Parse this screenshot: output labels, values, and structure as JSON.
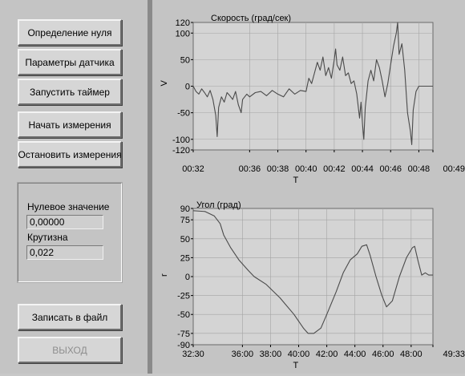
{
  "buttons": {
    "zero": "Определение нуля",
    "sensor_params": "Параметры датчика",
    "start_timer": "Запустить таймер",
    "start_measure": "Начать измерения",
    "stop_measure": "Остановить измерения",
    "save_file": "Записать в файл",
    "exit": "ВЫХОД"
  },
  "settings": {
    "zero_label": "Нулевое значение",
    "zero_value": "0,00000",
    "slope_label": "Крутизна",
    "slope_value": "0,022"
  },
  "colors": {
    "plot_bg": "#d4d4d4",
    "trace": "#4a4a4a",
    "grid": "#a4a4a4"
  },
  "chart_data": [
    {
      "type": "line",
      "title": "Скорость (град/сек)",
      "xlabel": "T",
      "ylabel": "V",
      "ylim": [
        -120,
        120
      ],
      "yticks": [
        120,
        100,
        50,
        0,
        -50,
        -100,
        -120
      ],
      "x_ticks": [
        "00:32",
        "00:36",
        "00:38",
        "00:40",
        "00:42",
        "00:44",
        "00:46",
        "00:48",
        "00:49"
      ],
      "x_tick_seconds": [
        32,
        36,
        38,
        40,
        42,
        44,
        46,
        48,
        49
      ],
      "xlim_seconds": [
        32,
        49
      ],
      "grid": true,
      "series": [
        {
          "points": [
            [
              32.0,
              0
            ],
            [
              32.2,
              -10
            ],
            [
              32.4,
              -15
            ],
            [
              32.6,
              -5
            ],
            [
              32.8,
              -12
            ],
            [
              33.0,
              -20
            ],
            [
              33.2,
              -8
            ],
            [
              33.4,
              -25
            ],
            [
              33.6,
              -55
            ],
            [
              33.7,
              -95
            ],
            [
              33.8,
              -40
            ],
            [
              34.0,
              -20
            ],
            [
              34.2,
              -30
            ],
            [
              34.4,
              -12
            ],
            [
              34.6,
              -18
            ],
            [
              34.8,
              -25
            ],
            [
              35.0,
              -10
            ],
            [
              35.2,
              -35
            ],
            [
              35.4,
              -50
            ],
            [
              35.5,
              -25
            ],
            [
              35.8,
              -15
            ],
            [
              36.0,
              -20
            ],
            [
              36.4,
              -12
            ],
            [
              36.8,
              -10
            ],
            [
              37.2,
              -18
            ],
            [
              37.6,
              -8
            ],
            [
              38.0,
              -15
            ],
            [
              38.4,
              -20
            ],
            [
              38.8,
              -5
            ],
            [
              39.2,
              -15
            ],
            [
              39.6,
              -8
            ],
            [
              40.0,
              -10
            ],
            [
              40.2,
              15
            ],
            [
              40.4,
              5
            ],
            [
              40.6,
              25
            ],
            [
              40.8,
              45
            ],
            [
              41.0,
              30
            ],
            [
              41.2,
              55
            ],
            [
              41.4,
              20
            ],
            [
              41.6,
              35
            ],
            [
              41.8,
              15
            ],
            [
              42.0,
              50
            ],
            [
              42.1,
              70
            ],
            [
              42.2,
              40
            ],
            [
              42.4,
              30
            ],
            [
              42.6,
              55
            ],
            [
              42.8,
              20
            ],
            [
              43.0,
              25
            ],
            [
              43.2,
              5
            ],
            [
              43.4,
              10
            ],
            [
              43.6,
              -15
            ],
            [
              43.8,
              -60
            ],
            [
              43.9,
              -30
            ],
            [
              44.0,
              -70
            ],
            [
              44.1,
              -100
            ],
            [
              44.2,
              -40
            ],
            [
              44.4,
              10
            ],
            [
              44.6,
              30
            ],
            [
              44.8,
              10
            ],
            [
              45.0,
              50
            ],
            [
              45.2,
              35
            ],
            [
              45.4,
              10
            ],
            [
              45.6,
              -20
            ],
            [
              45.8,
              5
            ],
            [
              46.0,
              40
            ],
            [
              46.2,
              75
            ],
            [
              46.4,
              100
            ],
            [
              46.5,
              120
            ],
            [
              46.6,
              60
            ],
            [
              46.8,
              80
            ],
            [
              47.0,
              30
            ],
            [
              47.2,
              -50
            ],
            [
              47.4,
              -85
            ],
            [
              47.5,
              -110
            ],
            [
              47.6,
              -45
            ],
            [
              47.8,
              -10
            ],
            [
              48.0,
              0
            ],
            [
              49.0,
              0
            ]
          ]
        }
      ]
    },
    {
      "type": "line",
      "title": "Угол (град)",
      "xlabel": "T",
      "ylabel": "r",
      "ylim": [
        -90,
        90
      ],
      "yticks": [
        90,
        75,
        50,
        25,
        0,
        -25,
        -50,
        -75,
        -90
      ],
      "x_ticks": [
        "32:30",
        "36:00",
        "38:00",
        "40:00",
        "42:00",
        "44:00",
        "46:00",
        "48:00",
        "49:33"
      ],
      "x_tick_seconds": [
        1950,
        2160,
        2280,
        2400,
        2520,
        2640,
        2760,
        2880,
        2973
      ],
      "xlim_seconds": [
        1950,
        2973
      ],
      "grid": true,
      "series": [
        {
          "points": [
            [
              1950,
              87
            ],
            [
              2000,
              86
            ],
            [
              2040,
              80
            ],
            [
              2065,
              70
            ],
            [
              2080,
              55
            ],
            [
              2110,
              38
            ],
            [
              2145,
              22
            ],
            [
              2185,
              8
            ],
            [
              2210,
              0
            ],
            [
              2260,
              -10
            ],
            [
              2320,
              -28
            ],
            [
              2380,
              -50
            ],
            [
              2420,
              -68
            ],
            [
              2440,
              -75
            ],
            [
              2465,
              -75
            ],
            [
              2495,
              -68
            ],
            [
              2520,
              -50
            ],
            [
              2560,
              -20
            ],
            [
              2590,
              5
            ],
            [
              2620,
              22
            ],
            [
              2650,
              30
            ],
            [
              2670,
              40
            ],
            [
              2690,
              42
            ],
            [
              2705,
              28
            ],
            [
              2730,
              0
            ],
            [
              2755,
              -25
            ],
            [
              2775,
              -40
            ],
            [
              2800,
              -32
            ],
            [
              2830,
              0
            ],
            [
              2860,
              25
            ],
            [
              2885,
              38
            ],
            [
              2895,
              40
            ],
            [
              2910,
              20
            ],
            [
              2925,
              2
            ],
            [
              2940,
              5
            ],
            [
              2955,
              2
            ],
            [
              2973,
              2
            ]
          ]
        }
      ]
    }
  ]
}
